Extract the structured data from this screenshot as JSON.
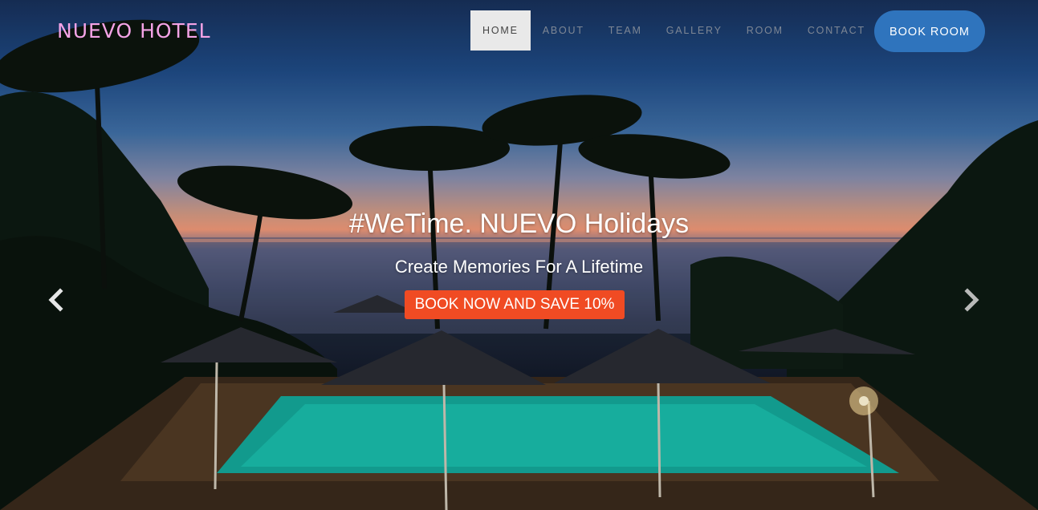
{
  "brand": {
    "logo_text": "NUEVO HOTEL",
    "logo_color": "#f4a3e6"
  },
  "nav": {
    "items": [
      {
        "label": "HOME",
        "active": true
      },
      {
        "label": "ABOUT",
        "active": false
      },
      {
        "label": "TEAM",
        "active": false
      },
      {
        "label": "GALLERY",
        "active": false
      },
      {
        "label": "ROOM",
        "active": false
      },
      {
        "label": "CONTACT",
        "active": false
      }
    ],
    "book_button_label": "BOOK ROOM"
  },
  "hero": {
    "headline": "#WeTime. NUEVO Holidays",
    "subheadline": "Create Memories For A Lifetime",
    "cta_label": "BOOK NOW AND SAVE 10%",
    "prev_icon": "chevron-left-icon",
    "next_icon": "chevron-right-icon"
  },
  "colors": {
    "book_button": "#2f74bd",
    "cta": "#f04b23",
    "nav_active_bg": "#e9e9e9"
  }
}
